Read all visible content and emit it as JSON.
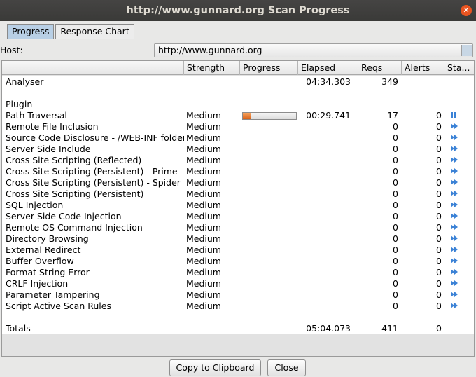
{
  "window": {
    "title": "http://www.gunnard.org Scan Progress"
  },
  "tabs": [
    {
      "label": "Progress"
    },
    {
      "label": "Response Chart"
    }
  ],
  "host": {
    "label": "Host:",
    "value": "http://www.gunnard.org"
  },
  "table": {
    "columns": [
      "",
      "Strength",
      "Progress",
      "Elapsed",
      "Reqs",
      "Alerts",
      "Sta..."
    ],
    "analyser": {
      "name": "Analyser",
      "elapsed": "04:34.303",
      "reqs": "349"
    },
    "plugin_header": "Plugin",
    "plugins": [
      {
        "name": "Path Traversal",
        "strength": "Medium",
        "progress": 0.14,
        "elapsed": "00:29.741",
        "reqs": "17",
        "alerts": "0",
        "status": "pause-icon"
      },
      {
        "name": "Remote File Inclusion",
        "strength": "Medium",
        "reqs": "0",
        "alerts": "0",
        "status": "play-icon"
      },
      {
        "name": "Source Code Disclosure - /WEB-INF folder",
        "strength": "Medium",
        "reqs": "0",
        "alerts": "0",
        "status": "play-icon"
      },
      {
        "name": "Server Side Include",
        "strength": "Medium",
        "reqs": "0",
        "alerts": "0",
        "status": "play-icon"
      },
      {
        "name": "Cross Site Scripting (Reflected)",
        "strength": "Medium",
        "reqs": "0",
        "alerts": "0",
        "status": "play-icon"
      },
      {
        "name": "Cross Site Scripting (Persistent) - Prime",
        "strength": "Medium",
        "reqs": "0",
        "alerts": "0",
        "status": "play-icon"
      },
      {
        "name": "Cross Site Scripting (Persistent) - Spider",
        "strength": "Medium",
        "reqs": "0",
        "alerts": "0",
        "status": "play-icon"
      },
      {
        "name": "Cross Site Scripting (Persistent)",
        "strength": "Medium",
        "reqs": "0",
        "alerts": "0",
        "status": "play-icon"
      },
      {
        "name": "SQL Injection",
        "strength": "Medium",
        "reqs": "0",
        "alerts": "0",
        "status": "play-icon"
      },
      {
        "name": "Server Side Code Injection",
        "strength": "Medium",
        "reqs": "0",
        "alerts": "0",
        "status": "play-icon"
      },
      {
        "name": "Remote OS Command Injection",
        "strength": "Medium",
        "reqs": "0",
        "alerts": "0",
        "status": "play-icon"
      },
      {
        "name": "Directory Browsing",
        "strength": "Medium",
        "reqs": "0",
        "alerts": "0",
        "status": "play-icon"
      },
      {
        "name": "External Redirect",
        "strength": "Medium",
        "reqs": "0",
        "alerts": "0",
        "status": "play-icon"
      },
      {
        "name": "Buffer Overflow",
        "strength": "Medium",
        "reqs": "0",
        "alerts": "0",
        "status": "play-icon"
      },
      {
        "name": "Format String Error",
        "strength": "Medium",
        "reqs": "0",
        "alerts": "0",
        "status": "play-icon"
      },
      {
        "name": "CRLF Injection",
        "strength": "Medium",
        "reqs": "0",
        "alerts": "0",
        "status": "play-icon"
      },
      {
        "name": "Parameter Tampering",
        "strength": "Medium",
        "reqs": "0",
        "alerts": "0",
        "status": "play-icon"
      },
      {
        "name": "Script Active Scan Rules",
        "strength": "Medium",
        "reqs": "0",
        "alerts": "0",
        "status": "play-icon"
      }
    ],
    "totals": {
      "name": "Totals",
      "elapsed": "05:04.073",
      "reqs": "411",
      "alerts": "0"
    }
  },
  "buttons": {
    "copy": "Copy to Clipboard",
    "close": "Close"
  },
  "colors": {
    "titlebar": "#3c3b37",
    "accent": "#e95420",
    "progress_fill": "#e07020",
    "status_icon": "#3b82d6"
  }
}
